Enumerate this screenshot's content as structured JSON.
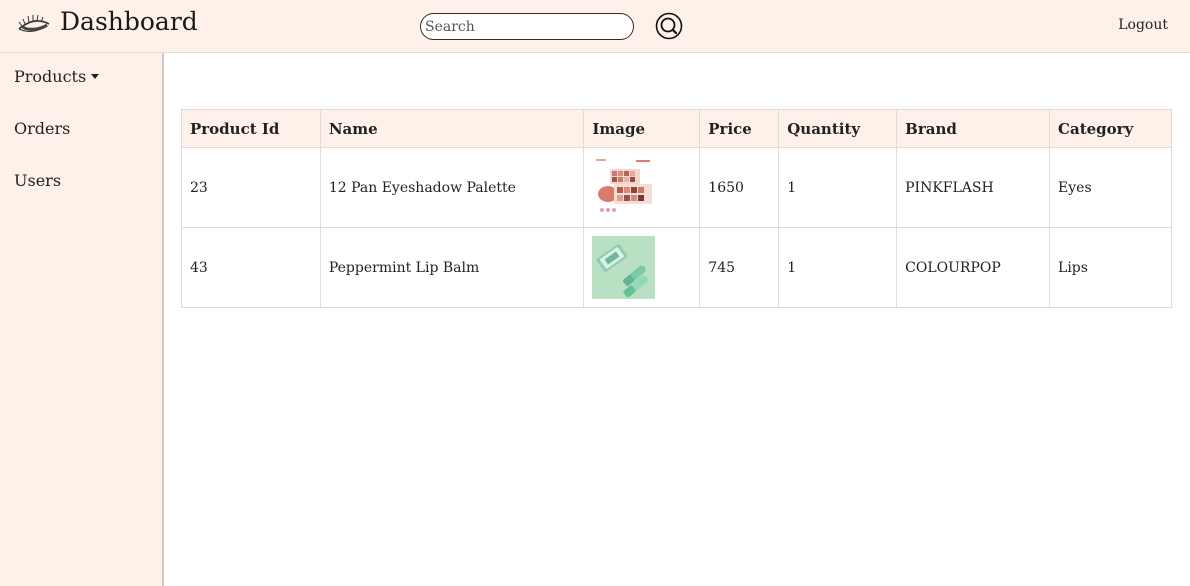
{
  "header": {
    "title": "Dashboard",
    "search_placeholder": "Search",
    "search_icon": "search-icon",
    "logout_label": "Logout",
    "background": "#fdf1e9"
  },
  "sidebar": {
    "items": [
      {
        "label": "Products",
        "has_dropdown": true
      },
      {
        "label": "Orders"
      },
      {
        "label": "Users"
      }
    ]
  },
  "table": {
    "columns": [
      "Product Id",
      "Name",
      "Image",
      "Price",
      "Quantity",
      "Brand",
      "Category"
    ],
    "rows": [
      {
        "id": "23",
        "name": "12 Pan Eyeshadow Palette",
        "image": "eyeshadow-palette-thumbnail",
        "price": "1650",
        "quantity": "1",
        "brand": "PINKFLASH",
        "category": "Eyes"
      },
      {
        "id": "43",
        "name": "Peppermint Lip Balm",
        "image": "lip-balm-thumbnail",
        "price": "745",
        "quantity": "1",
        "brand": "COLOURPOP",
        "category": "Lips"
      }
    ]
  }
}
